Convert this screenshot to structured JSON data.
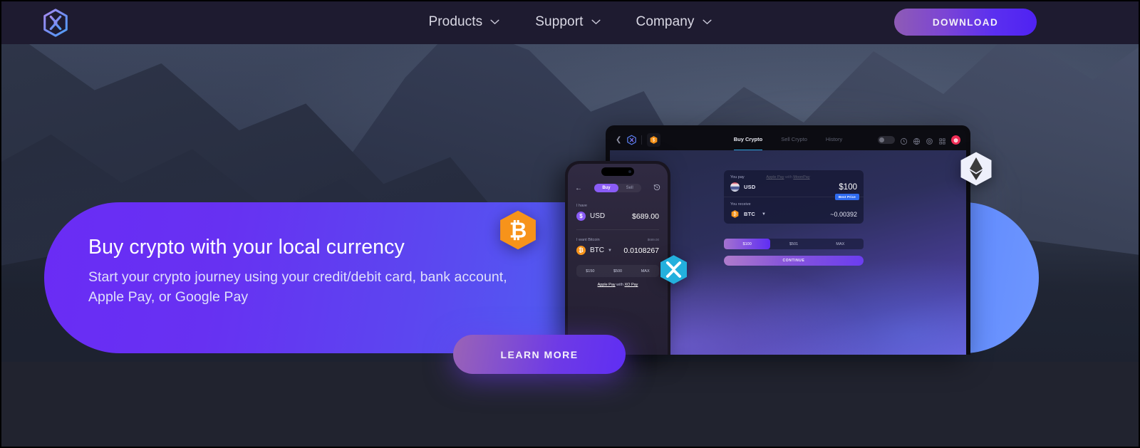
{
  "nav": {
    "logo_icon": "exodus-hex-logo",
    "items": [
      {
        "label": "Products",
        "icon": "chevron-down-icon"
      },
      {
        "label": "Support",
        "icon": "chevron-down-icon"
      },
      {
        "label": "Company",
        "icon": "chevron-down-icon"
      }
    ],
    "download_label": "DOWNLOAD"
  },
  "hero": {
    "title": "Buy crypto with your local currency",
    "subtitle": "Start your crypto journey using your credit/debit card, bank account, Apple Pay, or Google Pay",
    "cta_label": "LEARN MORE",
    "badges": [
      {
        "name": "bitcoin-hex-badge",
        "symbol": "₿",
        "color": "#f7931a"
      },
      {
        "name": "xrp-hex-badge",
        "symbol": "X",
        "color": "#23b0dd"
      },
      {
        "name": "ethereum-hex-badge",
        "symbol": "ETH",
        "color": "#eef0fb"
      }
    ]
  },
  "phone": {
    "back_icon": "arrow-left-icon",
    "history_icon": "history-icon",
    "segments": [
      {
        "label": "Buy",
        "active": true
      },
      {
        "label": "Sell",
        "active": false
      }
    ],
    "have": {
      "label": "I have",
      "currency": "USD",
      "icon": "usd-coin-icon",
      "amount": "$689.00"
    },
    "want": {
      "label": "I want Bitcoin",
      "sublabel": "$689.00",
      "currency": "BTC",
      "icon": "bitcoin-coin-icon",
      "amount": "0.0108267",
      "caret": "chevron-down-icon"
    },
    "quick_amounts": [
      "$150",
      "$500",
      "MAX"
    ],
    "pay_prefix": "Apple Pay",
    "pay_middle": "with",
    "pay_provider": "XO Pay"
  },
  "tablet": {
    "back_icon": "chevron-left-icon",
    "logo_icon": "exodus-hex-logo",
    "coin_icon": "usd-coin-icon",
    "tabs": [
      {
        "label": "Buy Crypto",
        "active": true
      },
      {
        "label": "Sell Crypto",
        "active": false
      },
      {
        "label": "History",
        "active": false
      }
    ],
    "toolbar_icons": [
      "toggle-switch",
      "history-icon",
      "globe-icon",
      "gear-icon",
      "qr-icon"
    ],
    "avatar_icon": "user-avatar",
    "pay": {
      "label": "You pay",
      "currency": "USD",
      "flag_icon": "us-flag-icon",
      "amount": "$100"
    },
    "receive": {
      "label": "You receive",
      "currency": "BTC",
      "icon": "bitcoin-coin-icon",
      "amount": "~0.00392",
      "badge": "Best Price",
      "caret": "chevron-down-icon"
    },
    "pay_prefix": "Apple Pay",
    "pay_middle": "with",
    "pay_provider": "MoonPay",
    "amount_options": [
      {
        "label": "$100",
        "active": true
      },
      {
        "label": "$501",
        "active": false
      },
      {
        "label": "MAX",
        "active": false
      }
    ],
    "continue_label": "CONTINUE"
  },
  "colors": {
    "nav_bg": "#1e1b30",
    "page_bg": "#21232f",
    "pill_start": "#6a2cf5",
    "pill_end": "#6f97ff",
    "accent_purple": "#6e3ae6",
    "accent_blue": "#2ea8e0",
    "bitcoin_orange": "#f7931a",
    "xrp_cyan": "#23b0dd",
    "avatar_pink": "#ef2d56"
  }
}
